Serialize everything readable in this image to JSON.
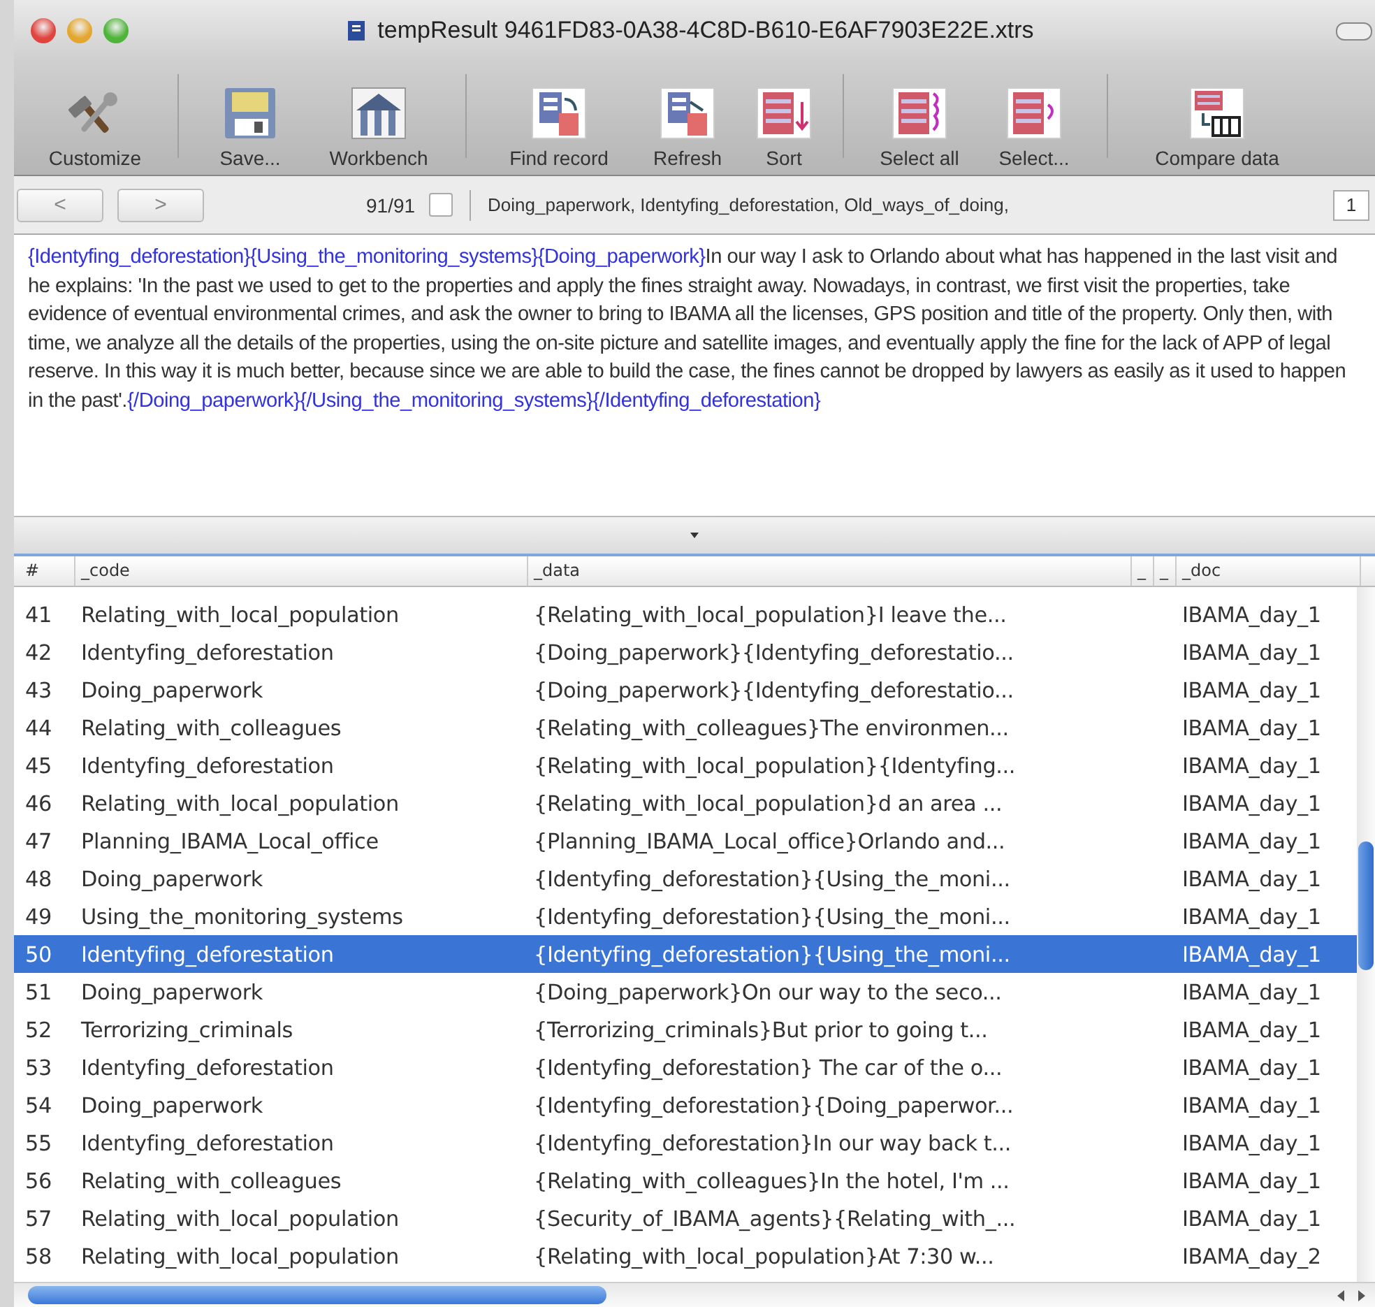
{
  "window": {
    "title": "tempResult 9461FD83-0A38-4C8D-B610-E6AF7903E22E.xtrs"
  },
  "toolbar": [
    {
      "kind": "customize",
      "label": "Customize"
    },
    {
      "kind": "save",
      "label": "Save..."
    },
    {
      "kind": "workbench",
      "label": "Workbench"
    },
    {
      "kind": "find",
      "label": "Find record"
    },
    {
      "kind": "refresh",
      "label": "Refresh"
    },
    {
      "kind": "sort",
      "label": "Sort"
    },
    {
      "kind": "select_all",
      "label": "Select all"
    },
    {
      "kind": "select",
      "label": "Select..."
    },
    {
      "kind": "compare",
      "label": "Compare data"
    }
  ],
  "navigation": {
    "previous": "<",
    "next": ">",
    "counter": "91/91",
    "checked": false,
    "tags": "Doing_paperwork, Identyfing_deforestation, Old_ways_of_doing,",
    "field_value": "1"
  },
  "text_view": {
    "segments": [
      {
        "kind": "tag",
        "text": "{Identyfing_deforestation}{Using_the_monitoring_systems}{Doing_paperwork}"
      },
      {
        "kind": "plain",
        "text": "In our way I ask to Orlando about what has happened in the last visit and he explains: 'In the past we used to get to the properties and apply the fines straight away. Nowadays, in contrast, we first visit the properties, take evidence of eventual environmental crimes, and ask the owner to bring to IBAMA all the licenses, GPS position and title of the property. Only then, with time, we analyze all the details of the properties, using the on-site picture and satellite images, and eventually apply the fine for the lack of APP of legal reserve. In this way it is much better, because since we are able to build the case, the fines cannot be dropped by lawyers as easily as it used to happen in the past'."
      },
      {
        "kind": "tag",
        "text": "{/Doing_paperwork}{/Using_the_monitoring_systems}{/Identyfing_deforestation}"
      }
    ]
  },
  "table": {
    "columns": [
      {
        "kind": "number",
        "label": "#"
      },
      {
        "kind": "code",
        "label": "_code"
      },
      {
        "kind": "data",
        "label": "_data"
      },
      {
        "kind": "narrow",
        "label": "_"
      },
      {
        "kind": "narrow",
        "label": "_"
      },
      {
        "kind": "doc",
        "label": "_doc"
      }
    ],
    "rows": [
      {
        "number": "41",
        "code": "Relating_with_local_population",
        "data": "{Relating_with_local_population}I leave the...",
        "doc": "IBAMA_day_1",
        "selected": false
      },
      {
        "number": "42",
        "code": "Identyfing_deforestation",
        "data": "{Doing_paperwork}{Identyfing_deforestatio...",
        "doc": "IBAMA_day_1",
        "selected": false
      },
      {
        "number": "43",
        "code": "Doing_paperwork",
        "data": "{Doing_paperwork}{Identyfing_deforestatio...",
        "doc": "IBAMA_day_1",
        "selected": false
      },
      {
        "number": "44",
        "code": "Relating_with_colleagues",
        "data": "{Relating_with_colleagues}The environmen...",
        "doc": "IBAMA_day_1",
        "selected": false
      },
      {
        "number": "45",
        "code": "Identyfing_deforestation",
        "data": "{Relating_with_local_population}{Identyfing...",
        "doc": "IBAMA_day_1",
        "selected": false
      },
      {
        "number": "46",
        "code": "Relating_with_local_population",
        "data": "{Relating_with_local_population}d an area ...",
        "doc": "IBAMA_day_1",
        "selected": false
      },
      {
        "number": "47",
        "code": "Planning_IBAMA_Local_office",
        "data": "{Planning_IBAMA_Local_office}Orlando and...",
        "doc": "IBAMA_day_1",
        "selected": false
      },
      {
        "number": "48",
        "code": "Doing_paperwork",
        "data": "{Identyfing_deforestation}{Using_the_moni...",
        "doc": "IBAMA_day_1",
        "selected": false
      },
      {
        "number": "49",
        "code": "Using_the_monitoring_systems",
        "data": "{Identyfing_deforestation}{Using_the_moni...",
        "doc": "IBAMA_day_1",
        "selected": false
      },
      {
        "number": "50",
        "code": "Identyfing_deforestation",
        "data": "{Identyfing_deforestation}{Using_the_moni...",
        "doc": "IBAMA_day_1",
        "selected": true
      },
      {
        "number": "51",
        "code": "Doing_paperwork",
        "data": "{Doing_paperwork}On our way to the seco...",
        "doc": "IBAMA_day_1",
        "selected": false
      },
      {
        "number": "52",
        "code": "Terrorizing_criminals",
        "data": "{Terrorizing_criminals}But prior to going t...",
        "doc": "IBAMA_day_1",
        "selected": false
      },
      {
        "number": "53",
        "code": "Identyfing_deforestation",
        "data": "{Identyfing_deforestation} The car of the o...",
        "doc": "IBAMA_day_1",
        "selected": false
      },
      {
        "number": "54",
        "code": "Doing_paperwork",
        "data": "{Identyfing_deforestation}{Doing_paperwor...",
        "doc": "IBAMA_day_1",
        "selected": false
      },
      {
        "number": "55",
        "code": "Identyfing_deforestation",
        "data": "{Identyfing_deforestation}In our way back t...",
        "doc": "IBAMA_day_1",
        "selected": false
      },
      {
        "number": "56",
        "code": "Relating_with_colleagues",
        "data": "{Relating_with_colleagues}In the hotel, I'm ...",
        "doc": "IBAMA_day_1",
        "selected": false
      },
      {
        "number": "57",
        "code": "Relating_with_local_population",
        "data": "{Security_of_IBAMA_agents}{Relating_with_...",
        "doc": "IBAMA_day_1",
        "selected": false
      },
      {
        "number": "58",
        "code": "Relating_with_local_population",
        "data": "{Relating_with_local_population}At 7:30 w...",
        "doc": "IBAMA_day_2",
        "selected": false
      }
    ]
  }
}
